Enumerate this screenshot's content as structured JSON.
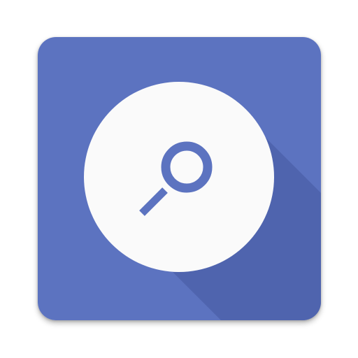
{
  "icon": {
    "name": "disc-search-icon",
    "colors": {
      "background": "#5C73C0",
      "long_shadow": "#4F64AE",
      "disc": "#FAFAFA",
      "glyph": "#5C73C0"
    }
  }
}
